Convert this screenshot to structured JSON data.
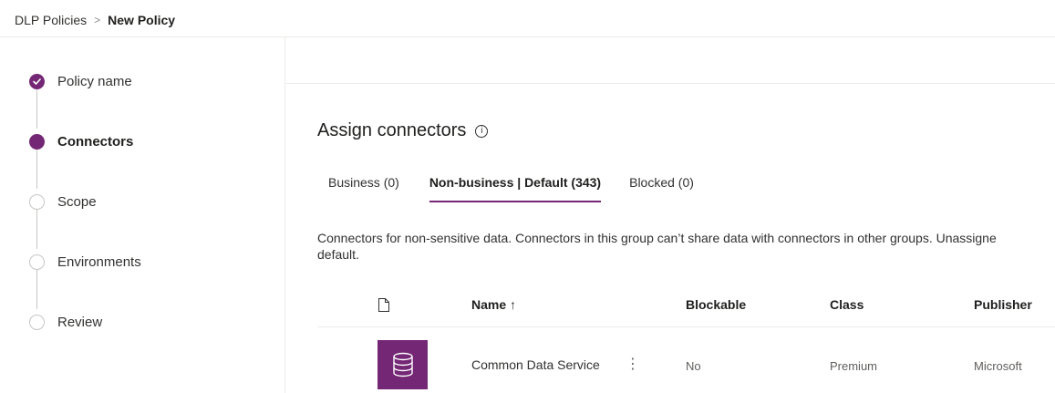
{
  "breadcrumb": {
    "parent": "DLP Policies",
    "separator": ">",
    "current": "New Policy"
  },
  "steps": [
    {
      "label": "Policy name",
      "state": "done"
    },
    {
      "label": "Connectors",
      "state": "current"
    },
    {
      "label": "Scope",
      "state": "pending"
    },
    {
      "label": "Environments",
      "state": "pending"
    },
    {
      "label": "Review",
      "state": "pending"
    }
  ],
  "main": {
    "title": "Assign connectors",
    "info_icon": "info-icon",
    "tabs": [
      {
        "label": "Business (0)",
        "active": false
      },
      {
        "label": "Non-business | Default (343)",
        "active": true
      },
      {
        "label": "Blocked (0)",
        "active": false
      }
    ],
    "description_line1": "Connectors for non-sensitive data. Connectors in this group can’t share data with connectors in other groups. Unassigne",
    "description_line2": "default.",
    "table": {
      "columns": {
        "icon": "file-icon",
        "name": "Name ↑",
        "blockable": "Blockable",
        "class": "Class",
        "publisher": "Publisher"
      },
      "rows": [
        {
          "icon": "database-icon",
          "name": "Common Data Service",
          "more": "⋮",
          "blockable": "No",
          "class": "Premium",
          "publisher": "Microsoft"
        }
      ]
    }
  },
  "colors": {
    "accent": "#742774",
    "divider": "#edebe9",
    "text": "#323130"
  }
}
